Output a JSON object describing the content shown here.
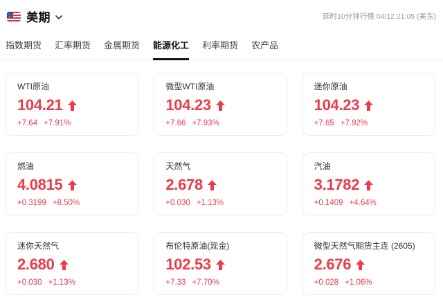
{
  "header": {
    "title": "美期",
    "flag_icon": "us-flag-icon",
    "chevron_icon": "chevron-down-icon",
    "quote_delay_note": "延时10分钟行情 04/12 21:05 (美东)"
  },
  "tabs": [
    {
      "label": "指数期货",
      "active": false
    },
    {
      "label": "汇率期货",
      "active": false
    },
    {
      "label": "金属期货",
      "active": false
    },
    {
      "label": "能源化工",
      "active": true
    },
    {
      "label": "利率期货",
      "active": false
    },
    {
      "label": "农产品",
      "active": false
    }
  ],
  "cards": [
    {
      "name": "WTI原油",
      "price": "104.21",
      "change": "+7.64",
      "change_pct": "+7.91%",
      "direction": "up"
    },
    {
      "name": "微型WTI原油",
      "price": "104.23",
      "change": "+7.66",
      "change_pct": "+7.93%",
      "direction": "up"
    },
    {
      "name": "迷你原油",
      "price": "104.23",
      "change": "+7.65",
      "change_pct": "+7.92%",
      "direction": "up"
    },
    {
      "name": "燃油",
      "price": "4.0815",
      "change": "+0.3199",
      "change_pct": "+8.50%",
      "direction": "up"
    },
    {
      "name": "天然气",
      "price": "2.678",
      "change": "+0.030",
      "change_pct": "+1.13%",
      "direction": "up"
    },
    {
      "name": "汽油",
      "price": "3.1782",
      "change": "+0.1409",
      "change_pct": "+4.64%",
      "direction": "up"
    },
    {
      "name": "迷你天然气",
      "price": "2.680",
      "change": "+0.030",
      "change_pct": "+1.13%",
      "direction": "up"
    },
    {
      "name": "布伦特原油(现金)",
      "price": "102.53",
      "change": "+7.33",
      "change_pct": "+7.70%",
      "direction": "up"
    },
    {
      "name": "微型天然气期货主连 (2605)",
      "price": "2.676",
      "change": "+0.028",
      "change_pct": "+1.06%",
      "direction": "up"
    }
  ],
  "colors": {
    "up_red": "#ed3b4a",
    "tab_active": "#111111",
    "card_border": "#ebebeb",
    "delay_text": "#999999"
  }
}
